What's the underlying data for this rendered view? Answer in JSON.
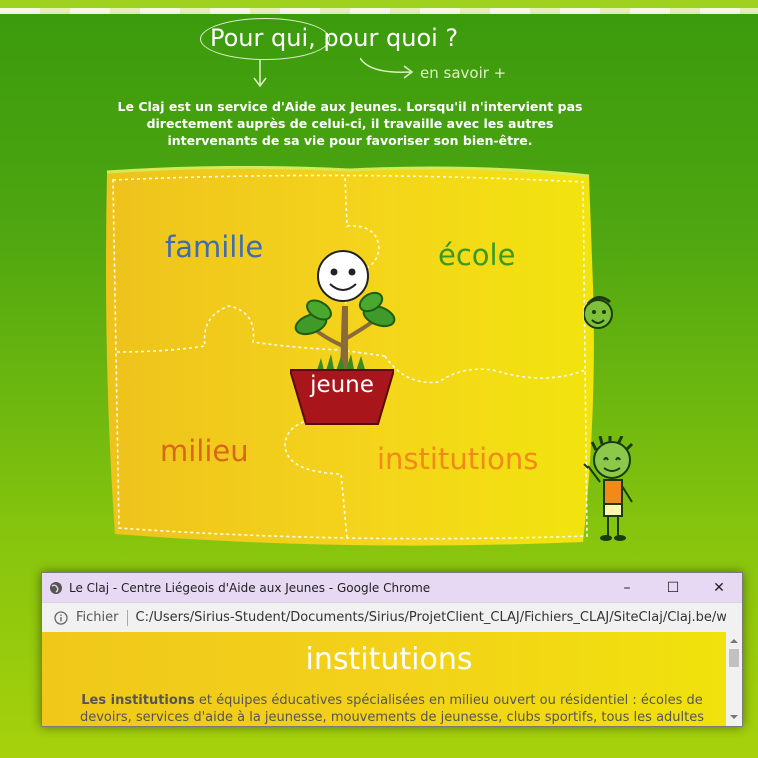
{
  "header": {
    "headline": "Pour qui, pour quoi ?",
    "more_link": "en savoir +"
  },
  "intro": "Le Claj est un service d'Aide aux Jeunes. Lorsqu'il n'intervient pas directement auprès de celui-ci, il travaille avec les autres intervenants de sa vie pour favoriser son bien-être.",
  "puzzle": {
    "famille": "famille",
    "ecole": "école",
    "milieu": "milieu",
    "institutions": "institutions",
    "jeune": "jeune"
  },
  "browser": {
    "title": "Le Claj - Centre Liégeois d'Aide aux Jeunes - Google Chrome",
    "file_label": "Fichier",
    "url": "C:/Users/Sirius-Student/Documents/Sirius/ProjetClient_CLAJ/Fichiers_CLAJ/SiteClaj/Claj.be/w...",
    "minimize": "–",
    "maximize": "☐",
    "close": "✕"
  },
  "popup": {
    "heading": "institutions",
    "bold_lead": "Les institutions",
    "text": " et équipes éducatives spécialisées en milieu ouvert ou résidentiel : écoles de devoirs, services d'aide à la jeunesse, mouvements de jeunesse, clubs sportifs, tous les adultes"
  },
  "colors": {
    "background_green": "#4ea611",
    "puzzle_yellow": "#f2cf1c",
    "famille": "#3f6cb0",
    "ecole": "#3a9a1e",
    "milieu": "#d9661a",
    "institutions": "#f28a1a",
    "pot_red": "#a8161b",
    "titlebar": "#e7d8f4"
  }
}
